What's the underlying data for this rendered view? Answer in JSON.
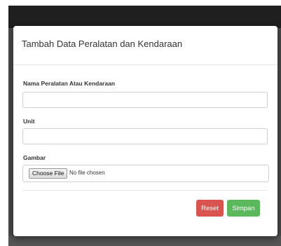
{
  "modal": {
    "title": "Tambah Data Peralatan dan Kendaraan"
  },
  "form": {
    "name_label": "Nama Peralatan Atau Kendaraan",
    "name_value": "",
    "unit_label": "Unit",
    "unit_value": "",
    "image_label": "Gambar",
    "file_button": "Choose File",
    "file_status": "No file chosen"
  },
  "actions": {
    "reset_label": "Reset",
    "save_label": "Simpan"
  },
  "colors": {
    "reset": "#d9534f",
    "save": "#5cb85c",
    "overlay": "#4a4a4a"
  }
}
